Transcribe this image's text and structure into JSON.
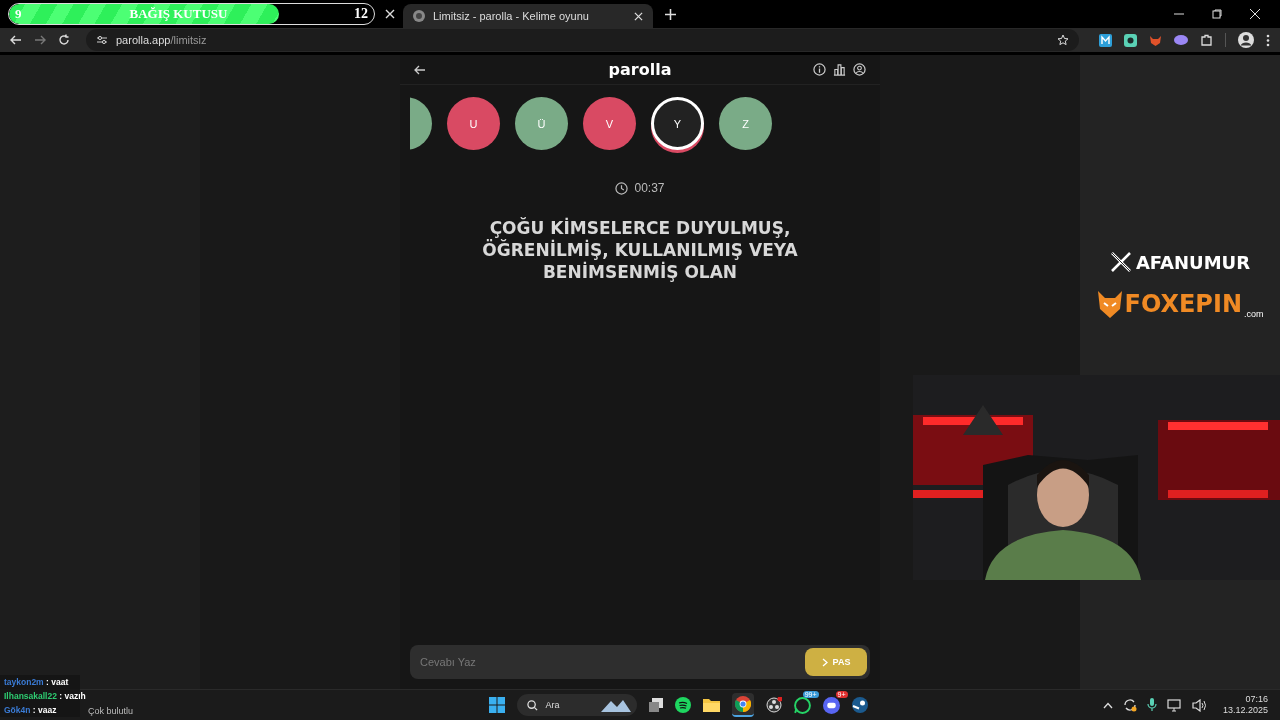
{
  "donation_bar": {
    "title": "BAĞIŞ KUTUSU",
    "start": "9",
    "goal": "12",
    "level": 0.74
  },
  "tabs": [
    {
      "title": "Limitsiz - parolla - Kelime oyunu",
      "selected": true
    }
  ],
  "address_bar": {
    "host": "parolla.app",
    "path": "/limitsiz"
  },
  "game": {
    "title": "parolla",
    "letters": [
      {
        "color": "#7aab87",
        "selected": false
      },
      {
        "letter": "U",
        "color": "#d94a63",
        "selected": false
      },
      {
        "letter": "Ü",
        "color": "#7aab87",
        "selected": false
      },
      {
        "letter": "V",
        "color": "#d94a63",
        "selected": false
      },
      {
        "letter": "Y",
        "color": "#222222",
        "selected": true
      },
      {
        "letter": "Z",
        "color": "#7aab87",
        "selected": false
      }
    ],
    "timer": "00:37",
    "question": "ÇOĞU KİMSELERCE DUYULMUŞ, ÖĞRENİLMİŞ, KULLANILMIŞ VEYA BENİMSENMİŞ OLAN",
    "answer": {
      "placeholder": "Cevabı Yaz"
    },
    "pass_button": "PAS"
  },
  "overlay": {
    "handle": "AFANUMUR",
    "sponsor": "FOXEPIN",
    "sponsor_suffix": ".com"
  },
  "chat": [
    {
      "user": "taykon2m",
      "message": ": vaat",
      "color": "#3a7bd5"
    },
    {
      "user": "Ilhansakall22",
      "message": ": vazıh",
      "color": "#2ecc71"
    },
    {
      "user": "Gök4n",
      "message": ": vaaz",
      "color": "#3a7bd5"
    }
  ],
  "taskbar": {
    "weather": "Çok bulutlu",
    "search": "Ara",
    "whatsapp_badge": "99+",
    "discord_badge": "9+",
    "time": "07:16",
    "date": "13.12.2025"
  }
}
